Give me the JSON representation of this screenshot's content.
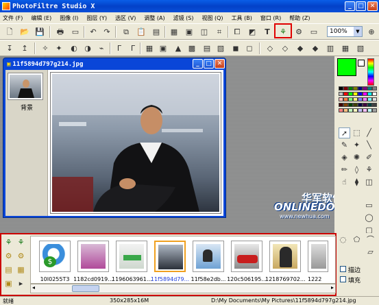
{
  "app": {
    "title": "PhotoFiltre Studio X"
  },
  "menu": [
    "文件 (F)",
    "编辑 (E)",
    "图像 (I)",
    "图层 (Y)",
    "选区 (V)",
    "调整 (A)",
    "滤镜 (S)",
    "视图 (Q)",
    "工具 (B)",
    "窗口 (R)",
    "帮助 (Z)"
  ],
  "toolbar": {
    "zoom": "100%",
    "text_tool": "T"
  },
  "image_window": {
    "title": "11f5894d797g214.jpg",
    "layer_label": "背景"
  },
  "watermark": {
    "cn": "华军软件园",
    "logo": "ONLINEDOWN",
    "url": "www.newhua.com"
  },
  "filmstrip": {
    "items": [
      {
        "label": "10I0255T3"
      },
      {
        "label": "1182cd0919..."
      },
      {
        "label": "1196063961..."
      },
      {
        "label": "11f5894d79...",
        "selected": true
      },
      {
        "label": "11f58e2db..."
      },
      {
        "label": "120c506195..."
      },
      {
        "label": "1218769702..."
      },
      {
        "label": "1222"
      }
    ],
    "options": {
      "border": "描边",
      "fill": "填充"
    }
  },
  "status": {
    "state": "就绪",
    "dimensions": "350x285x16M",
    "path": "D:\\My Documents\\My Pictures\\11f5894d797g214.jpg"
  },
  "colors": {
    "foreground": "#00ff00",
    "highlight": "#e00000"
  }
}
